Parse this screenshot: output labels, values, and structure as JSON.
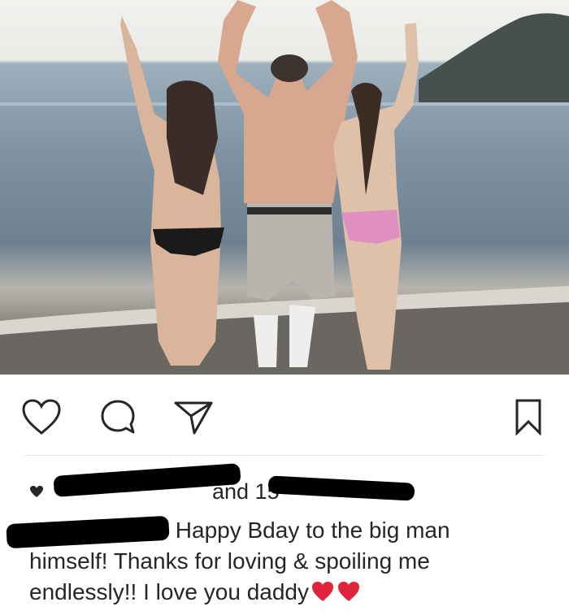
{
  "post": {
    "liked_by_text": "and 15",
    "caption_text": "Happy Bday to the big man himself! Thanks for loving & spoiling me endlessly!! I love you daddy",
    "caption_emojis": [
      "red-heart",
      "red-heart"
    ]
  },
  "actions": [
    "heart-icon",
    "comment-icon",
    "share-icon",
    "bookmark-icon"
  ],
  "colors": {
    "text": "#262626",
    "heart_emoji": "#e0243b",
    "redaction": "#000000"
  }
}
